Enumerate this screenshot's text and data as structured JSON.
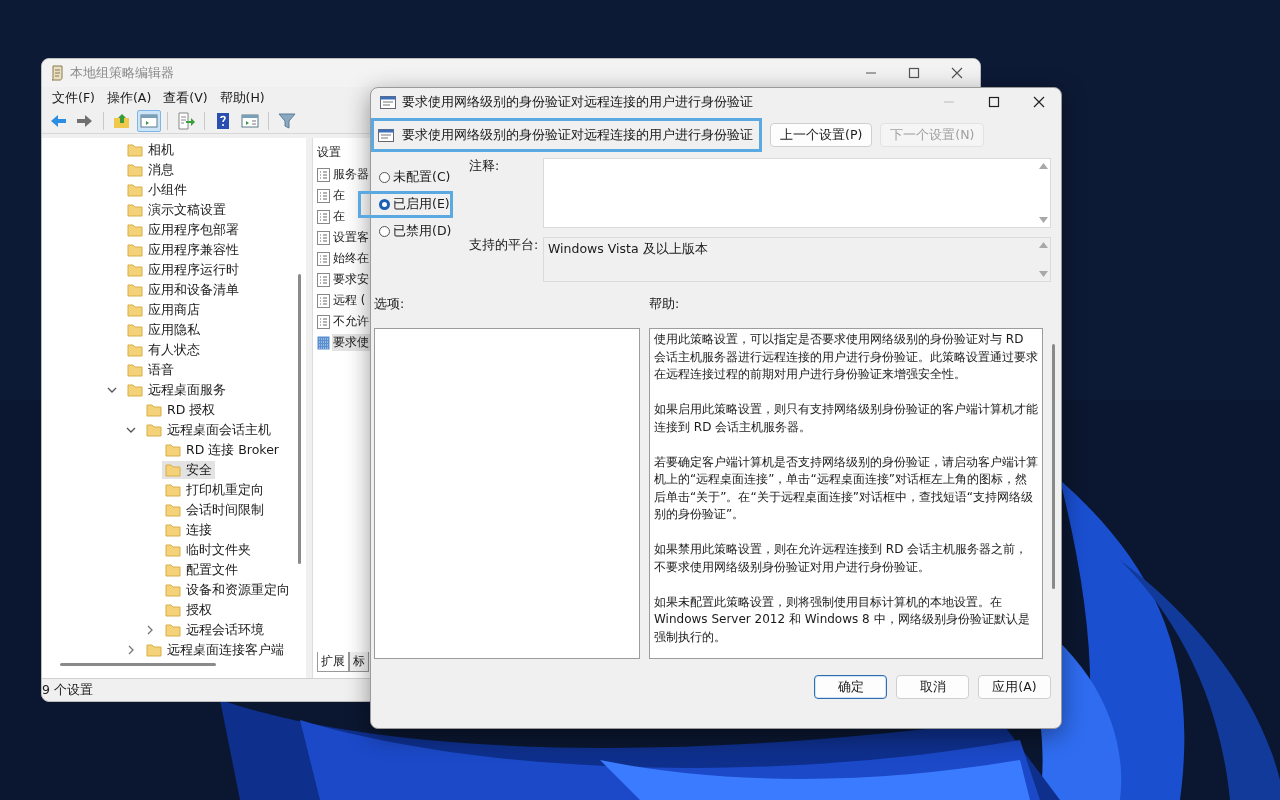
{
  "main_window": {
    "title": "本地组策略编辑器",
    "menu": [
      "文件(F)",
      "操作(A)",
      "查看(V)",
      "帮助(H)"
    ],
    "toolbar": [
      {
        "kind": "back",
        "pressed": false
      },
      {
        "kind": "forward",
        "pressed": false
      },
      {
        "kind": "sep"
      },
      {
        "kind": "up",
        "pressed": false
      },
      {
        "kind": "tree",
        "pressed": true
      },
      {
        "kind": "sep"
      },
      {
        "kind": "export",
        "pressed": false
      },
      {
        "kind": "sep"
      },
      {
        "kind": "help",
        "pressed": false
      },
      {
        "kind": "pane",
        "pressed": false
      },
      {
        "kind": "sep"
      },
      {
        "kind": "filter",
        "pressed": false
      }
    ],
    "tree": [
      {
        "label": "相机",
        "kind": "leaf",
        "selected": false
      },
      {
        "label": "消息",
        "kind": "leaf",
        "selected": false
      },
      {
        "label": "小组件",
        "kind": "leaf",
        "selected": false
      },
      {
        "label": "演示文稿设置",
        "kind": "leaf",
        "selected": false
      },
      {
        "label": "应用程序包部署",
        "kind": "leaf",
        "selected": false
      },
      {
        "label": "应用程序兼容性",
        "kind": "leaf",
        "selected": false
      },
      {
        "label": "应用程序运行时",
        "kind": "leaf",
        "selected": false
      },
      {
        "label": "应用和设备清单",
        "kind": "leaf",
        "selected": false
      },
      {
        "label": "应用商店",
        "kind": "leaf",
        "selected": false
      },
      {
        "label": "应用隐私",
        "kind": "leaf",
        "selected": false
      },
      {
        "label": "有人状态",
        "kind": "leaf",
        "selected": false
      },
      {
        "label": "语音",
        "kind": "leaf",
        "selected": false
      },
      {
        "label": "远程桌面服务",
        "kind": "node",
        "expanded": true,
        "selected": false,
        "children": [
          {
            "label": "RD 授权",
            "kind": "leaf",
            "selected": false
          },
          {
            "label": "远程桌面会话主机",
            "kind": "node",
            "expanded": true,
            "selected": false,
            "children": [
              {
                "label": "RD 连接 Broker",
                "kind": "leaf",
                "selected": false
              },
              {
                "label": "安全",
                "kind": "leaf",
                "selected": true
              },
              {
                "label": "打印机重定向",
                "kind": "leaf",
                "selected": false
              },
              {
                "label": "会话时间限制",
                "kind": "leaf",
                "selected": false
              },
              {
                "label": "连接",
                "kind": "leaf",
                "selected": false
              },
              {
                "label": "临时文件夹",
                "kind": "leaf",
                "selected": false
              },
              {
                "label": "配置文件",
                "kind": "leaf",
                "selected": false
              },
              {
                "label": "设备和资源重定向",
                "kind": "leaf",
                "selected": false
              },
              {
                "label": "授权",
                "kind": "leaf",
                "selected": false
              },
              {
                "label": "远程会话环境",
                "kind": "node",
                "expanded": false,
                "selected": false
              }
            ]
          },
          {
            "label": "远程桌面连接客户端",
            "kind": "node",
            "expanded": false,
            "selected": false
          }
        ]
      }
    ],
    "list": {
      "header": "设置",
      "items": [
        {
          "label": "服务器",
          "selected": false
        },
        {
          "label": "在",
          "selected": false
        },
        {
          "label": "在",
          "selected": false
        },
        {
          "label": "设置客",
          "selected": false
        },
        {
          "label": "始终在",
          "selected": false
        },
        {
          "label": "要求安",
          "selected": false
        },
        {
          "label": "远程 (",
          "selected": false
        },
        {
          "label": "不允许",
          "selected": false
        },
        {
          "label": "要求使",
          "selected": true
        }
      ]
    },
    "tabs": [
      {
        "label": "扩展",
        "selected": true
      },
      {
        "label": "标",
        "selected": false
      }
    ],
    "status_bar": "9 个设置"
  },
  "dialog": {
    "title": "要求使用网络级别的身份验证对远程连接的用户进行身份验证",
    "heading": {
      "text": "要求使用网络级别的身份验证对远程连接的用户进行身份验证",
      "highlighted": true
    },
    "nav_buttons": [
      {
        "label": "上一个设置(P)",
        "disabled": false
      },
      {
        "label": "下一个设置(N)",
        "disabled": true
      }
    ],
    "radios": [
      {
        "label": "未配置(C)",
        "selected": false,
        "highlighted": false
      },
      {
        "label": "已启用(E)",
        "selected": true,
        "highlighted": true
      },
      {
        "label": "已禁用(D)",
        "selected": false,
        "highlighted": false
      }
    ],
    "comment_label": "注释:",
    "platform_label": "支持的平台:",
    "platform": "Windows Vista 及以上版本",
    "options_label": "选项:",
    "help_label": "帮助:",
    "help": [
      "使用此策略设置，可以指定是否要求使用网络级别的身份验证对与 RD 会话主机服务器进行远程连接的用户进行身份验证。此策略设置通过要求在远程连接过程的前期对用户进行身份验证来增强安全性。",
      "如果启用此策略设置，则只有支持网络级别身份验证的客户端计算机才能连接到 RD 会话主机服务器。",
      "若要确定客户端计算机是否支持网络级别的身份验证，请启动客户端计算机上的“远程桌面连接”，单击“远程桌面连接”对话框左上角的图标，然后单击“关于”。在“关于远程桌面连接”对话框中，查找短语“支持网络级别的身份验证”。",
      "如果禁用此策略设置，则在允许远程连接到 RD 会话主机服务器之前，不要求使用网络级别身份验证对用户进行身份验证。",
      "如果未配置此策略设置，则将强制使用目标计算机的本地设置。在 Windows Server 2012 和 Windows 8 中，网络级别身份验证默认是强制执行的。"
    ],
    "buttons": [
      {
        "label": "确定",
        "default": true
      },
      {
        "label": "取消",
        "default": false
      },
      {
        "label": "应用(A)",
        "default": false
      }
    ]
  }
}
